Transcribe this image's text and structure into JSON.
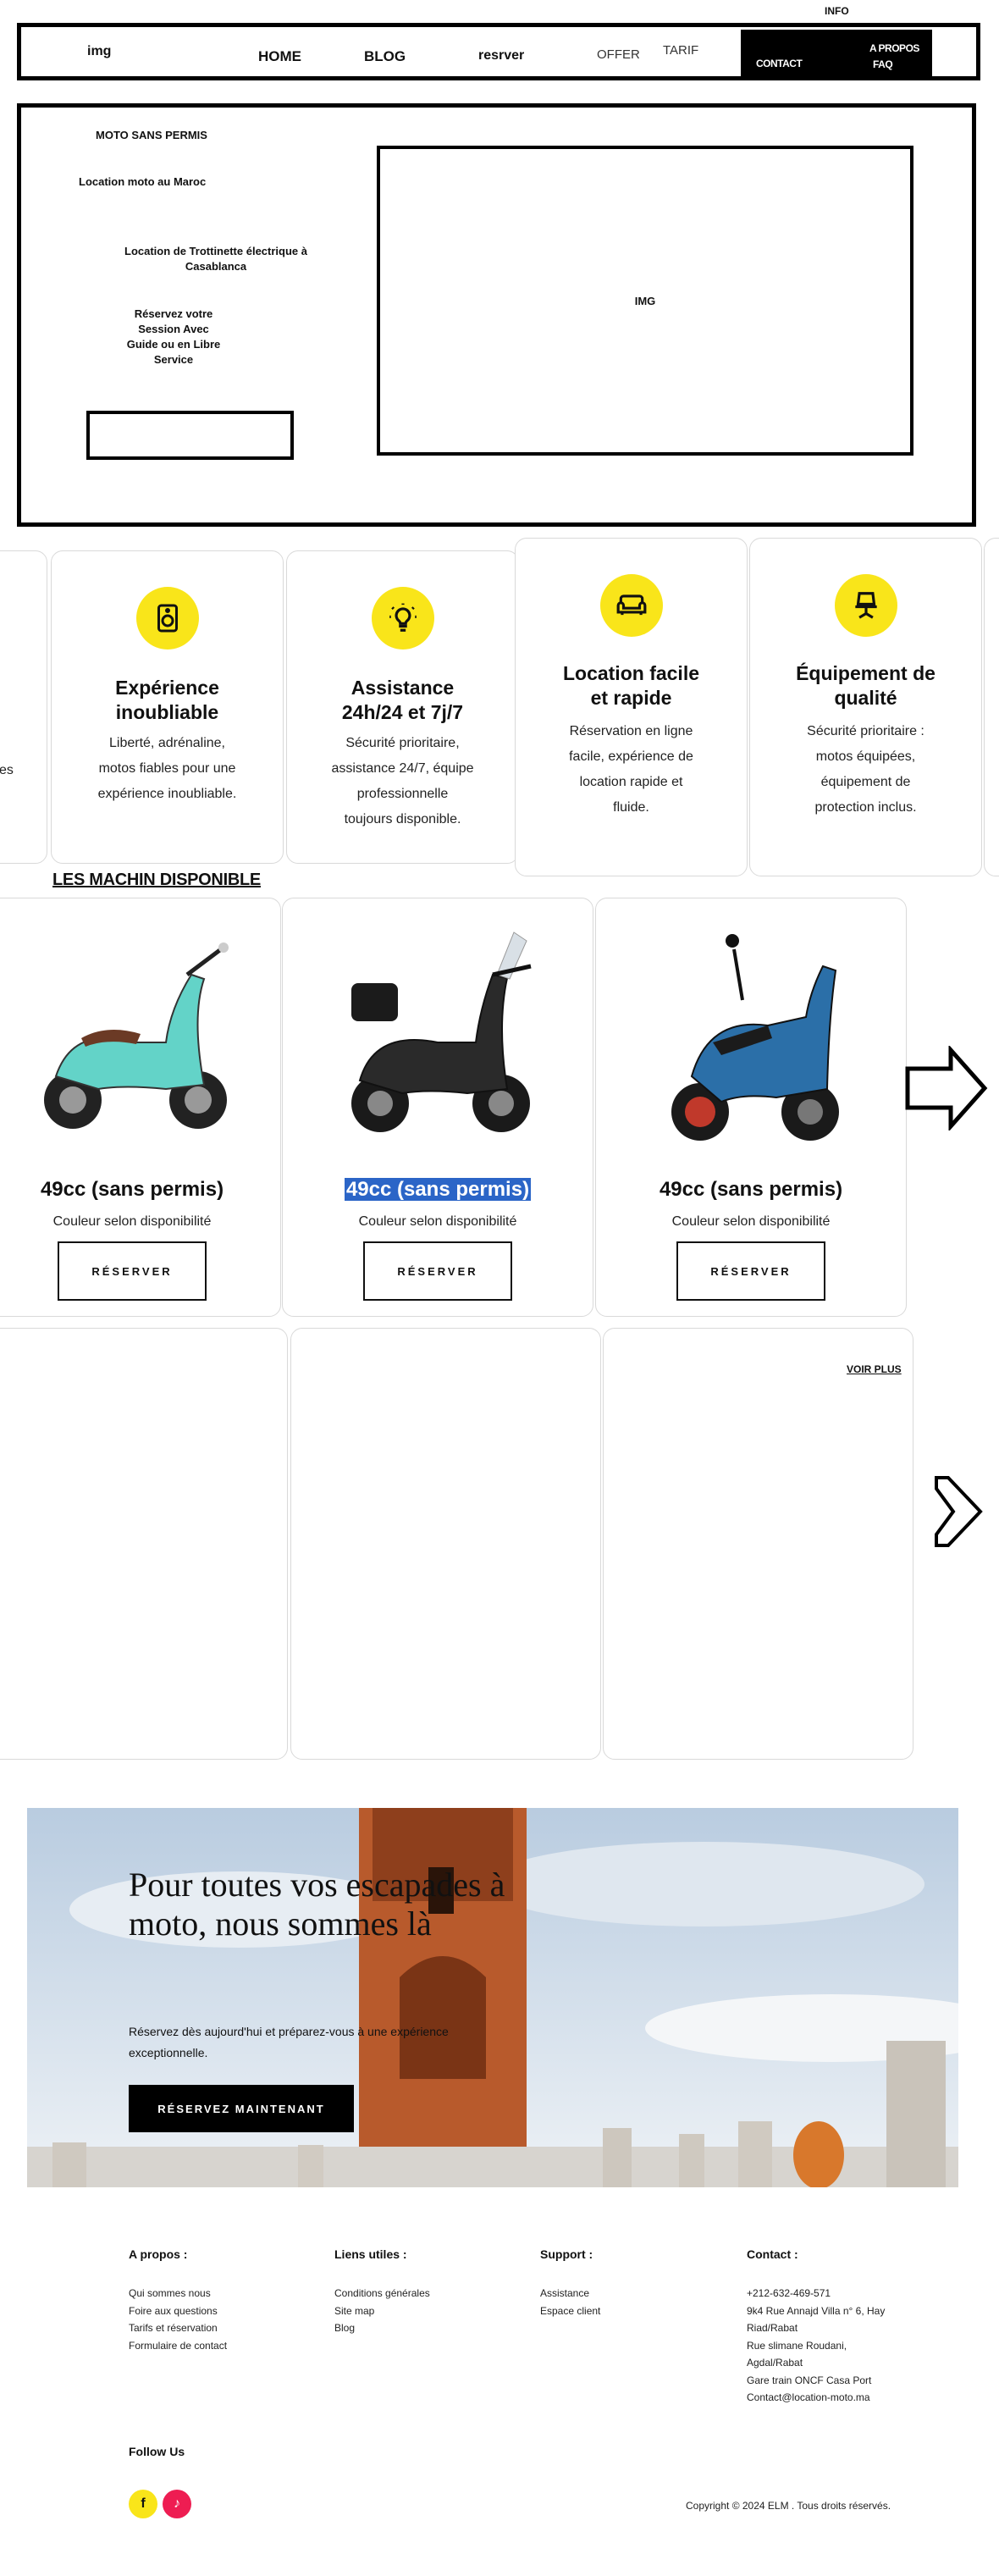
{
  "top": {
    "info": "INFO"
  },
  "nav": {
    "logo": "img",
    "home": "HOME",
    "blog": "BLOG",
    "reserve": "resrver",
    "offer": "OFFER",
    "tarif": "TARIF",
    "contact": "CONTACT",
    "apropos": "A PROPOS",
    "faq": "FAQ"
  },
  "hero": {
    "brand": "MOTO SANS PERMIS",
    "subtitle": "Location moto au Maroc",
    "line1": "Location de Trottinette électrique à",
    "line2": "Casablanca",
    "reserve1": "Réservez votre",
    "reserve2": "Session Avec",
    "reserve3": "Guide ou en Libre",
    "reserve4": "Service",
    "image_label": "IMG"
  },
  "features": [
    {
      "icon": "speaker-icon",
      "title1": "Expérience",
      "title2": "inoubliable",
      "d1": "Liberté, adrénaline,",
      "d2": "motos fiables pour une",
      "d3": "expérience inoubliable.",
      "d4": ""
    },
    {
      "icon": "lightbulb-icon",
      "title1": "Assistance",
      "title2": "24h/24 et 7j/7",
      "d1": "Sécurité prioritaire,",
      "d2": "assistance 24/7, équipe",
      "d3": "professionnelle",
      "d4": "toujours disponible."
    },
    {
      "icon": "sofa-icon",
      "title1": "Location facile",
      "title2": "et rapide",
      "d1": "Réservation en ligne",
      "d2": "facile, expérience de",
      "d3": "location rapide et",
      "d4": "fluide."
    },
    {
      "icon": "desk-chair-icon",
      "title1": "Équipement de",
      "title2": "qualité",
      "d1": "Sécurité prioritaire :",
      "d2": "motos équipées,",
      "d3": "équipement de",
      "d4": "protection inclus."
    }
  ],
  "partial_feature_text": "es",
  "machines": {
    "title": "LES MACHIN DISPONIBLE",
    "items": [
      {
        "name": "49cc (sans permis)",
        "sub": "Couleur selon disponibilité",
        "button": "RÉSERVER",
        "color": "#63d3c8"
      },
      {
        "name": "49cc (sans permis)",
        "sub": "Couleur selon disponibilité",
        "button": "RÉSERVER",
        "color": "#2a2a2a"
      },
      {
        "name": "49cc (sans permis)",
        "sub": "Couleur selon disponibilité",
        "button": "RÉSERVER",
        "color": "#2b6fa8"
      }
    ],
    "voir_plus": "VOIR PLUS"
  },
  "banner": {
    "title": "Pour toutes vos escapades à moto, nous sommes là",
    "desc": "Réservez dès aujourd'hui et préparez-vous à une expérience exceptionnelle.",
    "button": "RÉSERVEZ MAINTENANT"
  },
  "footer": {
    "about": {
      "title": "A propos :",
      "links": [
        "Qui sommes nous",
        "Foire aux questions",
        "Tarifs et réservation",
        "Formulaire de contact"
      ]
    },
    "useful": {
      "title": "Liens utiles :",
      "links": [
        "Conditions générales",
        "Site map",
        "Blog"
      ]
    },
    "support": {
      "title": "Support :",
      "links": [
        "Assistance",
        "Espace client"
      ]
    },
    "contact": {
      "title": "Contact :",
      "lines": [
        "+212-632-469-571",
        "9k4 Rue Annajd Villa n° 6, Hay",
        "Riad/Rabat",
        "Rue slimane Roudani,",
        "Agdal/Rabat",
        "Gare train ONCF Casa Port",
        "Contact@location-moto.ma"
      ]
    },
    "follow": "Follow Us",
    "facebook": "f",
    "tiktok": "♪",
    "copyright": "Copyright © 2024 ELM . Tous droits réservés."
  },
  "colors": {
    "accent": "#f9e51a",
    "highlight": "#2b65c7",
    "tiktok": "#ee1d52"
  }
}
